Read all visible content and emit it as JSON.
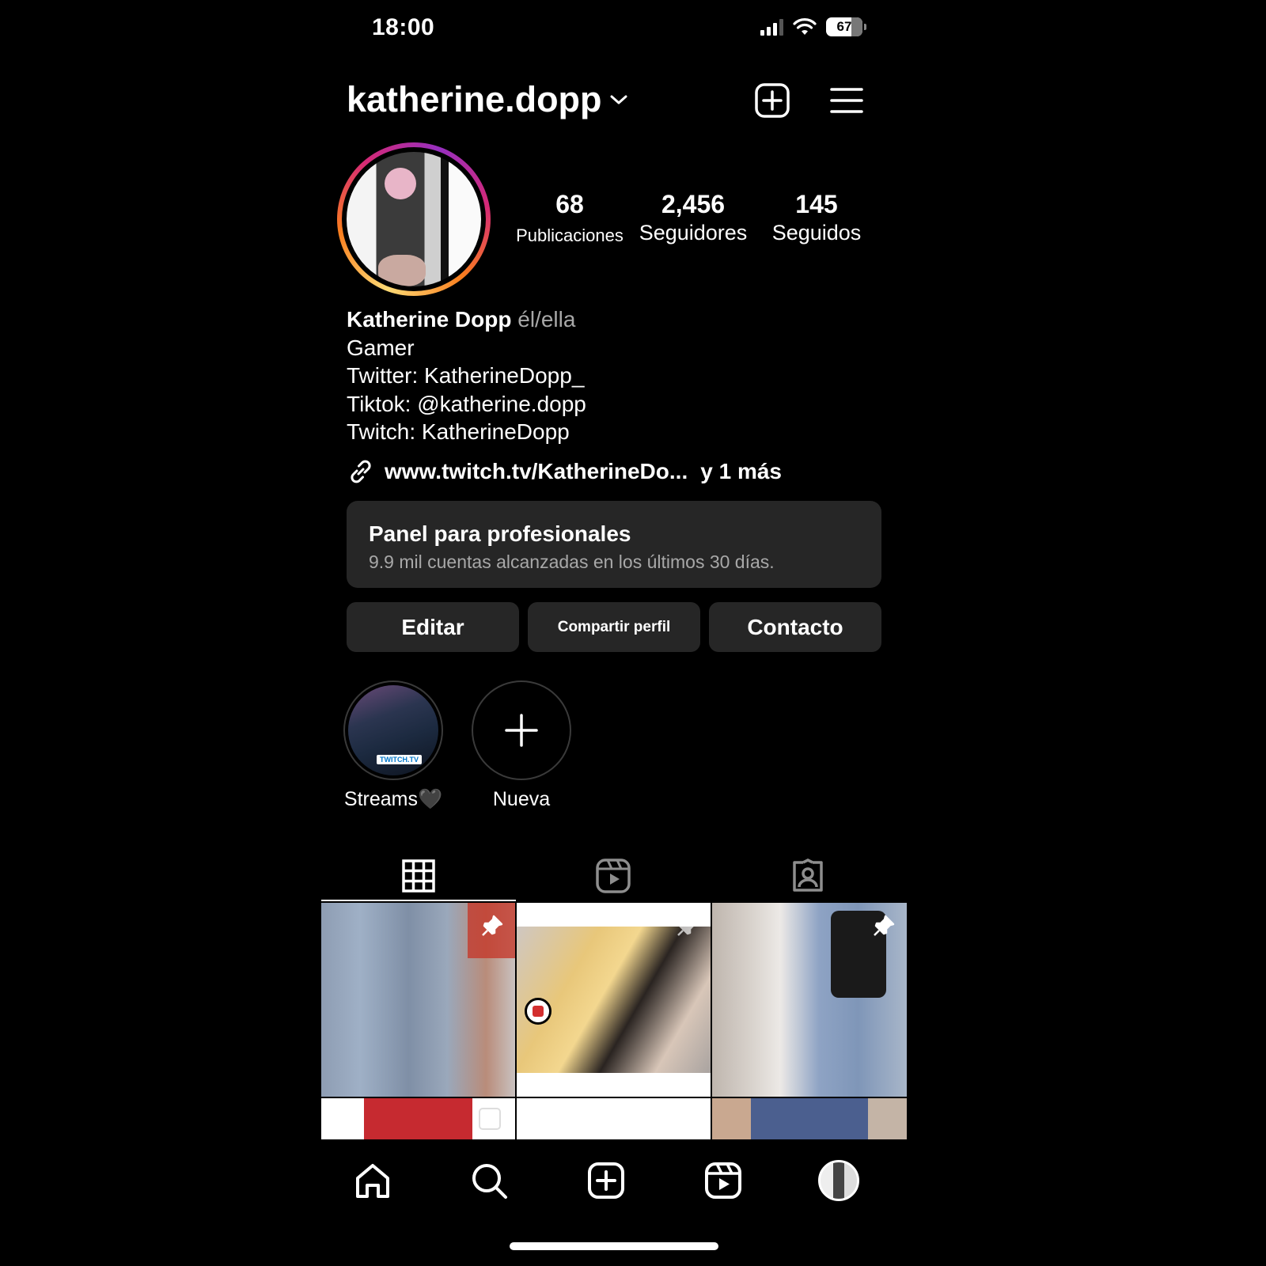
{
  "status_bar": {
    "time": "18:00",
    "battery": "67"
  },
  "header": {
    "username": "katherine.dopp"
  },
  "stats": [
    {
      "value": "68",
      "label": "Publicaciones"
    },
    {
      "value": "2,456",
      "label": "Seguidores"
    },
    {
      "value": "145",
      "label": "Seguidos"
    }
  ],
  "bio": {
    "name": "Katherine Dopp",
    "pronouns": "él/ella",
    "lines": [
      "Gamer",
      "Twitter: KatherineDopp_",
      "Tiktok: @katherine.dopp",
      "Twitch: KatherineDopp"
    ],
    "link": "www.twitch.tv/KatherineDo...",
    "link_more": "y 1 más"
  },
  "pro_panel": {
    "title": "Panel para profesionales",
    "subtitle": "9.9 mil cuentas alcanzadas en los últimos 30 días."
  },
  "actions": {
    "edit": "Editar",
    "share": "Compartir perfil",
    "contact": "Contacto"
  },
  "highlights": [
    {
      "label": "Streams🖤",
      "thumb_tag": "TWITCH.TV"
    },
    {
      "label": "Nueva"
    }
  ],
  "tabs": [
    "grid-icon",
    "reels-icon",
    "tagged-icon"
  ],
  "bottom_nav": [
    "home-icon",
    "search-icon",
    "create-icon",
    "reels-icon",
    "profile-avatar"
  ],
  "colors": {
    "background": "#000000",
    "surface": "#262626",
    "secondary_text": "#a8a8a8"
  }
}
